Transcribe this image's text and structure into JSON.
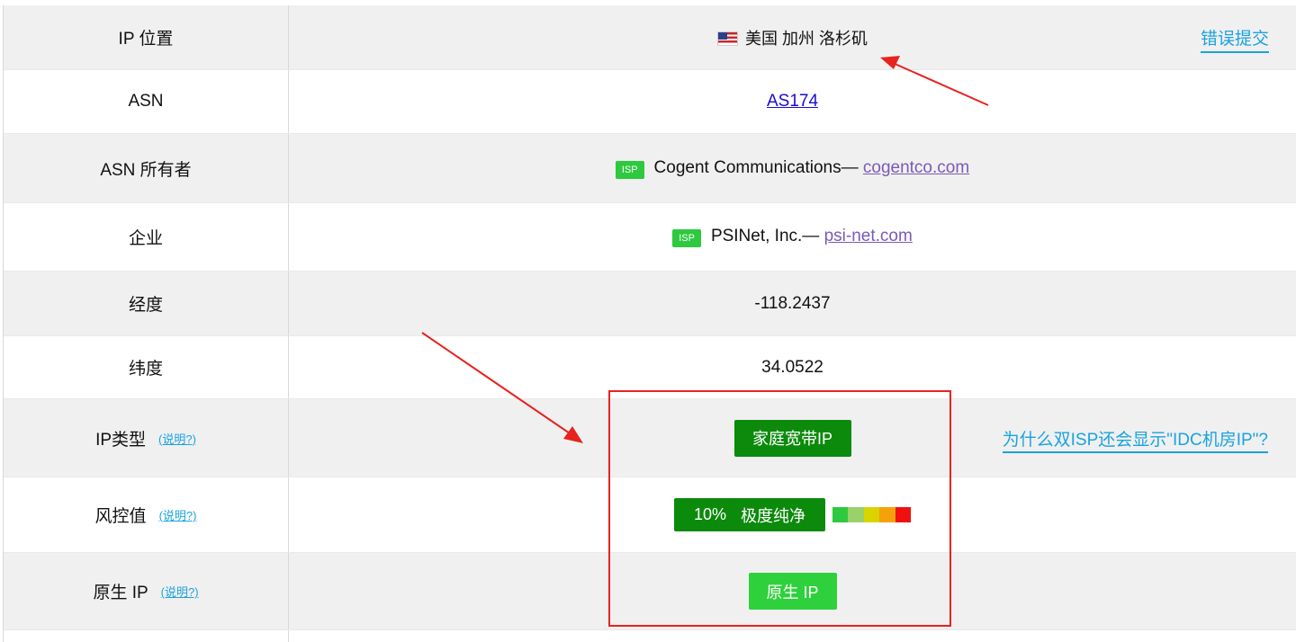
{
  "rows": {
    "location": {
      "label": "IP 位置",
      "value": "美国 加州 洛杉矶",
      "flag_icon": "us-flag-icon",
      "report_link": "错误提交"
    },
    "asn": {
      "label": "ASN",
      "value": "AS174"
    },
    "asn_owner": {
      "label": "ASN 所有者",
      "badge": "ISP",
      "name": "Cogent Communications—",
      "domain": "cogentco.com"
    },
    "company": {
      "label": "企业",
      "badge": "ISP",
      "name": "PSINet, Inc.—",
      "domain": "psi-net.com"
    },
    "longitude": {
      "label": "经度",
      "value": "-118.2437"
    },
    "latitude": {
      "label": "纬度",
      "value": "34.0522"
    },
    "ip_type": {
      "label": "IP类型",
      "help": "(说明?)",
      "tag": "家庭宽带IP",
      "why_link": "为什么双ISP还会显示\"IDC机房IP\"?"
    },
    "risk": {
      "label": "风控值",
      "help": "(说明?)",
      "percent": "10%",
      "level": "极度纯净",
      "level_segments": [
        "#2ec93e",
        "#9bd16a",
        "#d9d400",
        "#f5a10c",
        "#f01010"
      ]
    },
    "native": {
      "label": "原生 IP",
      "help": "(说明?)",
      "tag": "原生 IP"
    }
  },
  "colors": {
    "accent_link": "#1aa3e0",
    "tag_dark": "#0c8a0c",
    "tag_light": "#2ed13c",
    "highlight": "#e8231f"
  }
}
